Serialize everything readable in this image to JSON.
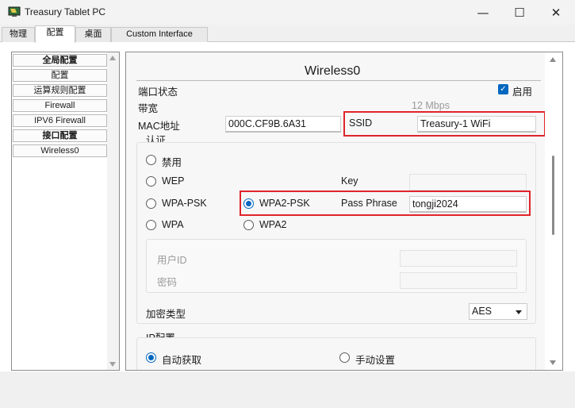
{
  "window": {
    "title": "Treasury Tablet PC",
    "minimize_glyph": "—",
    "maximize_glyph": "☐",
    "close_glyph": "✕"
  },
  "tabs": [
    {
      "label": "物理"
    },
    {
      "label": "配置"
    },
    {
      "label": "桌面"
    },
    {
      "label": "Custom Interface"
    }
  ],
  "sidebar": {
    "items": [
      {
        "label": "全局配置"
      },
      {
        "label": "配置"
      },
      {
        "label": "运算规则配置"
      },
      {
        "label": "Firewall"
      },
      {
        "label": "IPV6 Firewall"
      },
      {
        "label": "接口配置"
      },
      {
        "label": "Wireless0"
      }
    ]
  },
  "panel": {
    "title": "Wireless0",
    "port_status_label": "端口状态",
    "enable_label": "启用",
    "enable_checked": true,
    "bandwidth_label": "带宽",
    "bandwidth_value": "12 Mbps",
    "mac_label": "MAC地址",
    "mac_value": "000C.CF9B.6A31",
    "ssid_label": "SSID",
    "ssid_value": "Treasury-1 WiFi",
    "auth": {
      "section_label": "认证",
      "disabled_label": "禁用",
      "wep_label": "WEP",
      "key_label": "Key",
      "wpa_psk_label": "WPA-PSK",
      "wpa2_psk_label": "WPA2-PSK",
      "pass_phrase_label": "Pass Phrase",
      "pass_phrase_value": "tongji2024",
      "wpa_label": "WPA",
      "wpa2_label": "WPA2",
      "selected": "WPA2-PSK",
      "user_id_label": "用户ID",
      "password_label": "密码"
    },
    "encryption_label": "加密类型",
    "encryption_value": "AES",
    "ip": {
      "section_label": "IP配置",
      "dhcp_label": "自动获取",
      "static_label": "手动设置",
      "selected": "自动获取"
    }
  },
  "colors": {
    "accent": "#0067c0",
    "highlight_box": "#e0242b"
  }
}
